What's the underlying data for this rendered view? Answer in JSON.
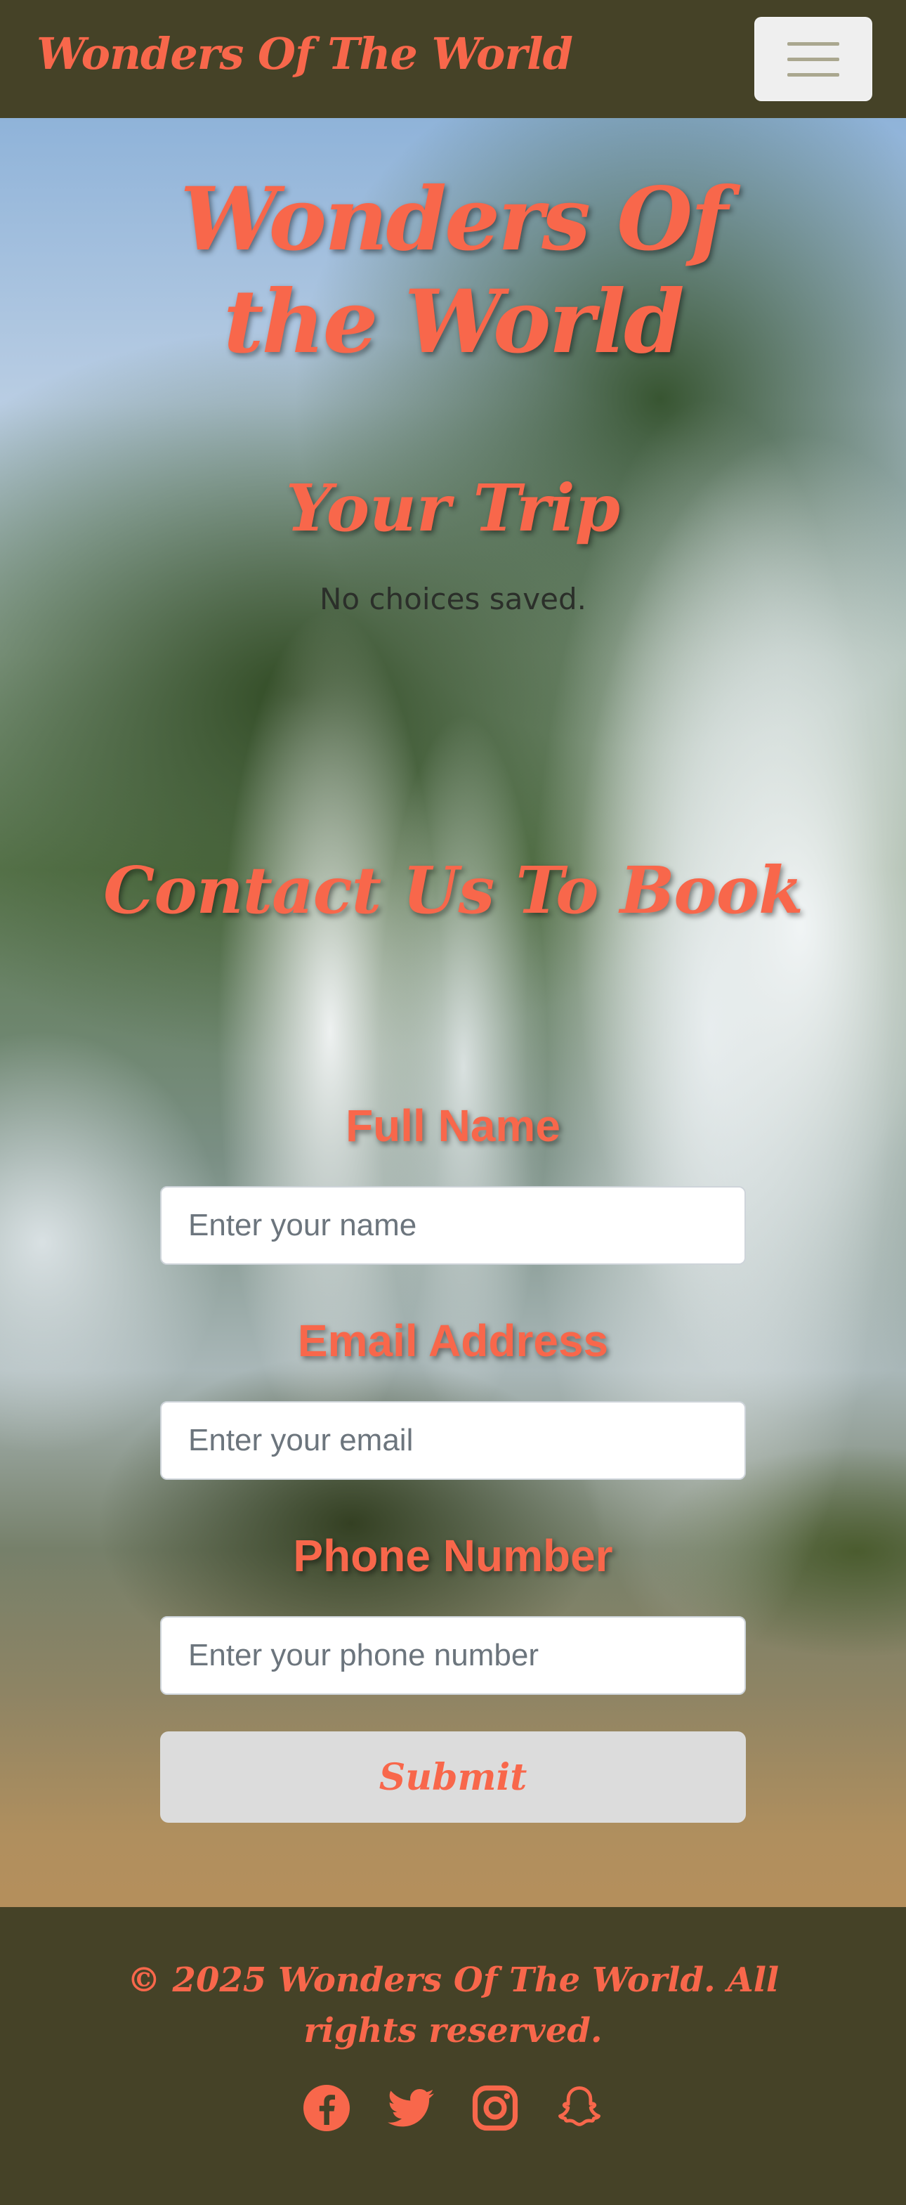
{
  "navbar": {
    "brand": "Wonders Of The World",
    "toggle_icon": "hamburger-menu-icon"
  },
  "hero": {
    "title": "Wonders Of the World",
    "background_image": "waterfall-landscape"
  },
  "trip": {
    "title": "Your Trip",
    "status": "No choices saved."
  },
  "contact": {
    "title": "Contact Us To Book",
    "name_label": "Full Name",
    "name_placeholder": "Enter your name",
    "email_label": "Email Address",
    "email_placeholder": "Enter your email",
    "phone_label": "Phone Number",
    "phone_placeholder": "Enter your phone number",
    "submit_label": "Submit"
  },
  "footer": {
    "copyright": "© 2025 Wonders Of The World. All rights reserved.",
    "socials": [
      "facebook-icon",
      "twitter-icon",
      "instagram-icon",
      "snapchat-icon"
    ]
  },
  "colors": {
    "accent": "#f8674b",
    "nav_background": "#454227",
    "submit_background": "#dcdcdc"
  }
}
